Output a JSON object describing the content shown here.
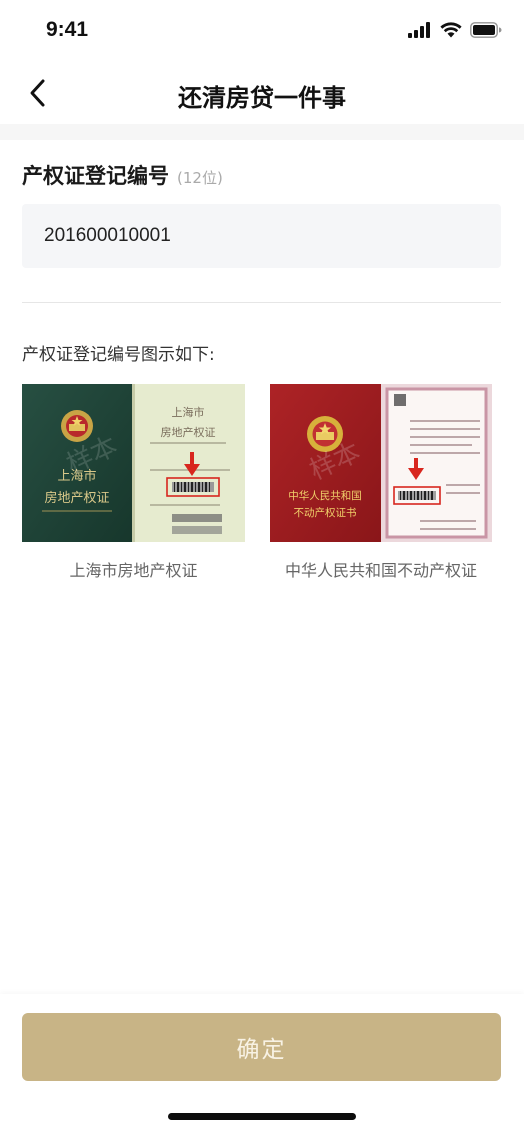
{
  "status_bar": {
    "time": "9:41"
  },
  "nav": {
    "title": "还清房贷一件事"
  },
  "field": {
    "label": "产权证登记编号",
    "hint": "(12位)",
    "value": "201600010001"
  },
  "example": {
    "title": "产权证登记编号图示如下:",
    "certificates": [
      {
        "caption": "上海市房地产权证",
        "cover_line1": "上海市",
        "cover_line2": "房地产权证",
        "page_line1": "上海市",
        "page_line2": "房地产权证",
        "watermark": "样本"
      },
      {
        "caption": "中华人民共和国不动产权证",
        "cover_line1": "中华人民共和国",
        "cover_line2": "不动产权证书",
        "watermark": "样本"
      }
    ]
  },
  "footer": {
    "confirm_label": "确定"
  },
  "colors": {
    "accent": "#c8b486",
    "input_bg": "#f5f6f8",
    "cert_green": "#1f4538",
    "cert_red": "#9e1c1f",
    "highlight_red": "#d8261e"
  }
}
